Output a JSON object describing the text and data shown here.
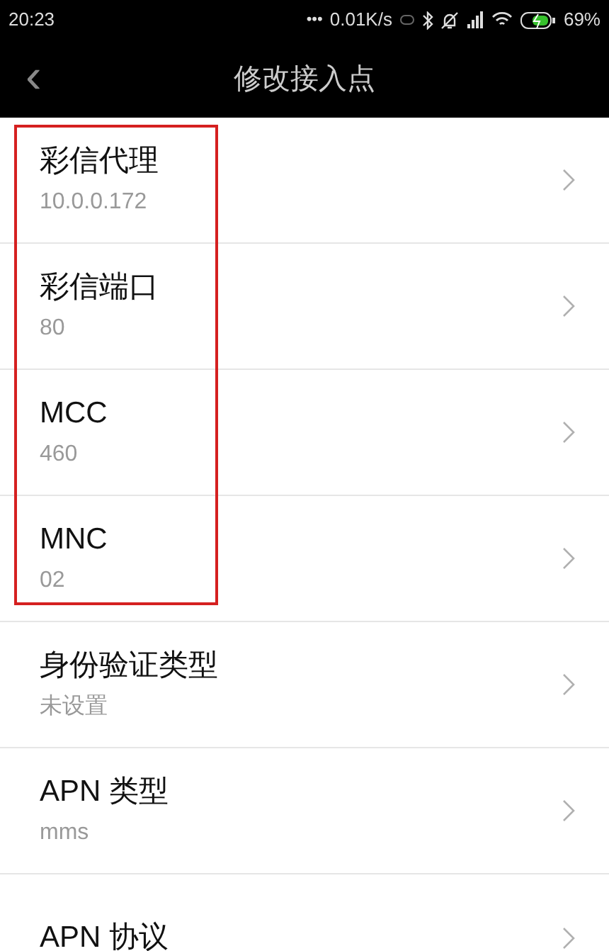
{
  "status_bar": {
    "time": "20:23",
    "dots": "•••",
    "speed": "0.01K/s",
    "battery": "69%"
  },
  "header": {
    "back": "‹",
    "title": "修改接入点"
  },
  "rows": [
    {
      "label": "彩信代理",
      "value": "10.0.0.172",
      "highlighted": true
    },
    {
      "label": "彩信端口",
      "value": "80",
      "highlighted": true
    },
    {
      "label": "MCC",
      "value": "460",
      "highlighted": true
    },
    {
      "label": "MNC",
      "value": "02",
      "highlighted": true
    },
    {
      "label": "身份验证类型",
      "value": "未设置",
      "highlighted": false
    },
    {
      "label": "APN 类型",
      "value": "mms",
      "highlighted": false
    },
    {
      "label": "APN 协议",
      "highlighted": false
    }
  ]
}
